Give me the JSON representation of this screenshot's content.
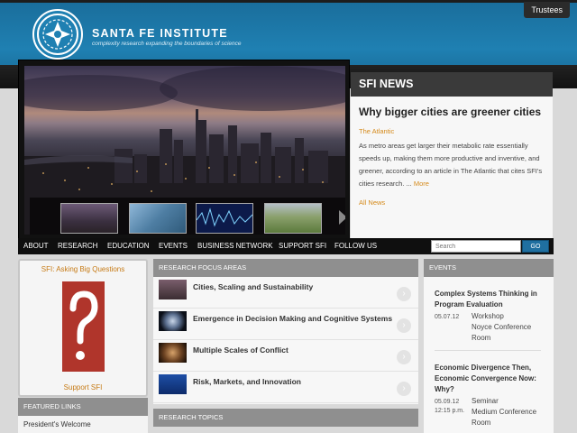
{
  "top": {
    "trustees_label": "Trustees"
  },
  "brand": {
    "name": "SANTA FE INSTITUTE",
    "tagline": "complexity research expanding the boundaries of science"
  },
  "news": {
    "heading": "SFI NEWS",
    "headline": "Why bigger cities are greener cities",
    "source": "The Atlantic",
    "body": "As metro areas get larger their metabolic rate essentially speeds up, making them more productive and inventive, and greener, according to an article in The Atlantic that cites SFI's cities research. ...",
    "more": "More",
    "all_news": "All News"
  },
  "nav": {
    "items": [
      "ABOUT",
      "RESEARCH",
      "EDUCATION",
      "EVENTS",
      "BUSINESS NETWORK",
      "SUPPORT SFI",
      "FOLLOW US"
    ],
    "search_placeholder": "Search",
    "go_label": "GO"
  },
  "left": {
    "asking_title": "SFI: Asking Big Questions",
    "support_label": "Support SFI",
    "featured_heading": "FEATURED LINKS",
    "featured_items": [
      "President's Welcome"
    ]
  },
  "research": {
    "heading": "RESEARCH FOCUS AREAS",
    "items": [
      "Cities, Scaling and Sustainability",
      "Emergence in Decision Making and Cognitive Systems",
      "Multiple Scales of Conflict",
      "Risk, Markets, and Innovation"
    ],
    "topics_heading": "RESEARCH TOPICS"
  },
  "events": {
    "heading": "EVENTS",
    "items": [
      {
        "title": "Complex Systems Thinking in Program Evaluation",
        "date": "05.07.12",
        "time": "",
        "type": "Workshop",
        "location": "Noyce Conference Room"
      },
      {
        "title": "Economic Divergence Then, Economic Convergence Now: Why?",
        "date": "05.09.12",
        "time": "12:15 p.m.",
        "type": "Seminar",
        "location": "Medium Conference Room"
      }
    ]
  },
  "colors": {
    "header_blue": "#1f80b2",
    "accent_orange": "#d58a1b",
    "panel_gray": "#8f8f8f"
  }
}
